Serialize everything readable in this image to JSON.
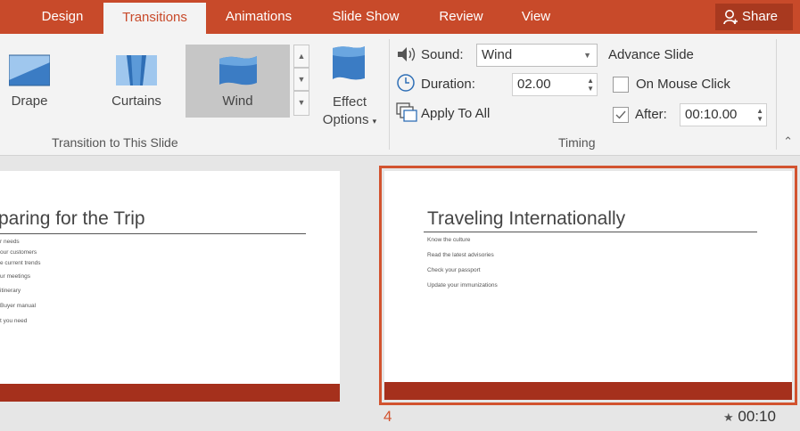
{
  "tabs": [
    {
      "label": "Design",
      "active": false
    },
    {
      "label": "Transitions",
      "active": true
    },
    {
      "label": "Animations",
      "active": false
    },
    {
      "label": "Slide Show",
      "active": false
    },
    {
      "label": "Review",
      "active": false
    },
    {
      "label": "View",
      "active": false
    }
  ],
  "share_label": "Share",
  "transition_gallery": {
    "items": [
      {
        "label": "Drape",
        "icon": "drape-icon",
        "selected": false
      },
      {
        "label": "Curtains",
        "icon": "curtains-icon",
        "selected": false
      },
      {
        "label": "Wind",
        "icon": "wind-icon",
        "selected": true
      }
    ],
    "effect_options_line1": "Effect",
    "effect_options_line2": "Options",
    "group_label": "Transition to This Slide"
  },
  "timing": {
    "sound_label": "Sound:",
    "sound_value": "Wind",
    "duration_label": "Duration:",
    "duration_value": "02.00",
    "apply_all_label": "Apply To All",
    "advance_label": "Advance Slide",
    "on_mouse_click_label": "On Mouse Click",
    "on_mouse_click_checked": false,
    "after_label": "After:",
    "after_checked": true,
    "after_value": "00:10.00",
    "group_label": "Timing"
  },
  "slides": [
    {
      "title": "paring for the Trip",
      "bullets": [
        "r needs",
        "our customers",
        "e current trends",
        "ur meetings",
        "itinerary",
        "Buyer manual",
        "t you need"
      ]
    },
    {
      "number": "4",
      "title": "Traveling Internationally",
      "bullets": [
        "Know the culture",
        "Read the latest advisories",
        "Check your passport",
        "Update your immunizations"
      ],
      "transition_marker": "★",
      "duration": "00:10"
    }
  ],
  "colors": {
    "accent": "#c84a2a",
    "slide_bar": "#a5301c",
    "selection": "#d2532f"
  }
}
